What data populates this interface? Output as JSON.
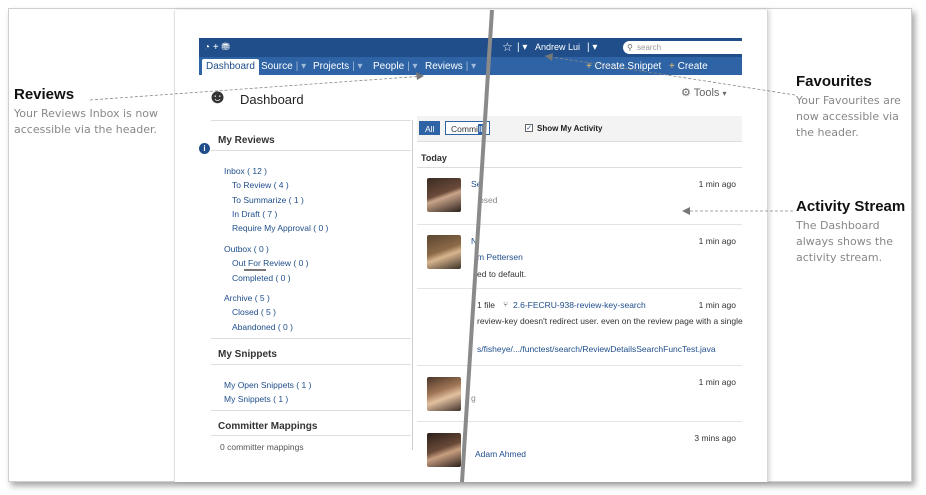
{
  "callouts": {
    "reviews": {
      "title": "Reviews",
      "text_line1": "Your Reviews Inbox is now",
      "text_line2": "accessible via the header."
    },
    "favourites": {
      "title": "Favourites",
      "text_line1": "Your Favourites are",
      "text_line2": "now accessible via",
      "text_line3": "the header."
    },
    "activity": {
      "title": "Activity Stream",
      "text_line1": "The Dashboard",
      "text_line2": "always shows the",
      "text_line3": "activity stream."
    }
  },
  "header": {
    "user": "Andrew Lui",
    "search_placeholder": "search",
    "create_snippet": "Create Snippet",
    "create_review": "Create Review",
    "tabs": [
      "Dashboard",
      "Source",
      "Projects",
      "People",
      "Reviews"
    ]
  },
  "page": {
    "title": "Dashboard",
    "tools": "Tools"
  },
  "my_reviews": {
    "heading": "My Reviews",
    "inbox": "Inbox ( 12 )",
    "to_review": "To Review ( 4 )",
    "to_summarize": "To Summarize ( 1 )",
    "in_draft": "In Draft ( 7 )",
    "require_approval": "Require My Approval ( 0 )",
    "outbox": "Outbox ( 0 )",
    "out_for_review": "Out For Review ( 0 )",
    "completed": "Completed ( 0 )",
    "archive": "Archive ( 5 )",
    "closed": "Closed ( 5 )",
    "abandoned": "Abandoned ( 0 )"
  },
  "my_snippets": {
    "heading": "My Snippets",
    "open": "My Open Snippets ( 1 )",
    "mine": "My Snippets ( 1 )"
  },
  "committer": {
    "heading": "Committer Mappings",
    "count": "0  committer mappings"
  },
  "filters": {
    "all": "All",
    "commits": "Commits",
    "commits_left": "Commi",
    "commits_right": "ll",
    "show_activity": "Show My Activity"
  },
  "stream": {
    "today": "Today",
    "items": [
      {
        "time": "1 min ago",
        "line1": "Se",
        "line2": "osed"
      },
      {
        "time": "1 min ago",
        "line1": "N",
        "line2": "m Pettersen",
        "line3": "ed to default."
      },
      {
        "time": "1 min ago",
        "files": "1 file",
        "branch": "2.6-FECRU-938-review-key-search",
        "line2": "review-key doesn't redirect user. even on the review page with a single",
        "line3": "s/fisheye/.../functest/search/ReviewDetailsSearchFuncTest.java"
      },
      {
        "time": "1 min ago",
        "line1": "g"
      },
      {
        "time": "3 mins ago",
        "line1": "Adam Ahmed"
      }
    ]
  }
}
